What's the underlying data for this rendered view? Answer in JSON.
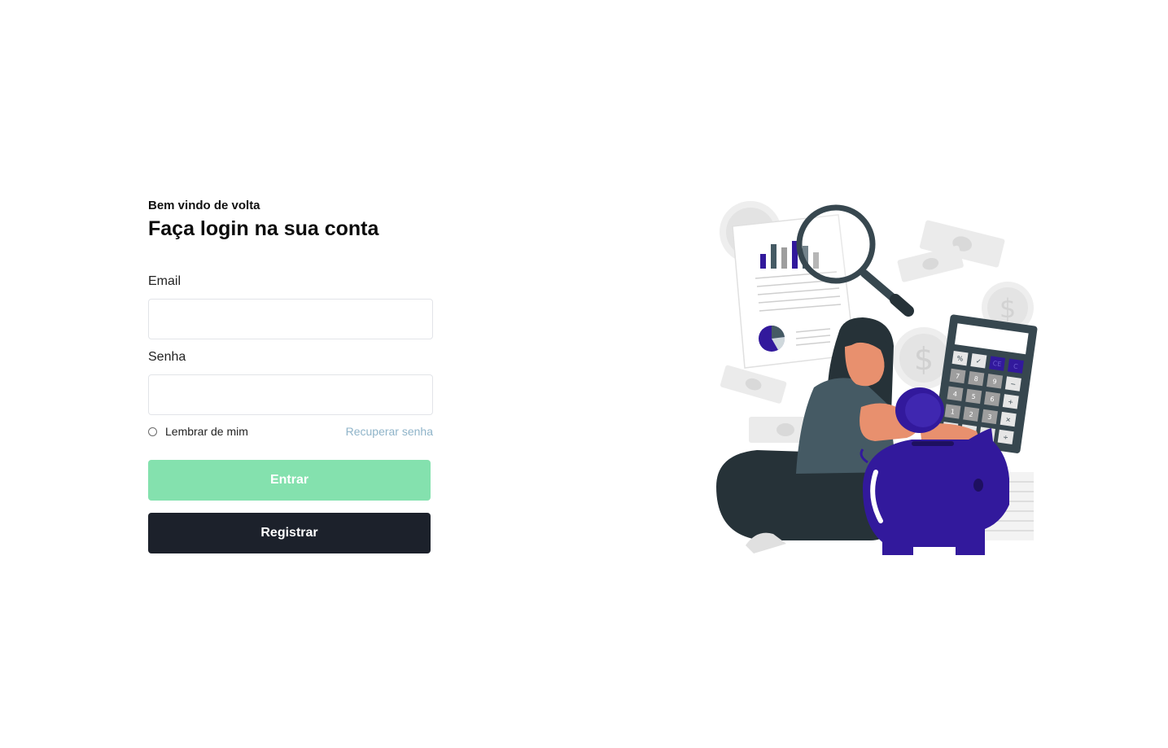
{
  "login": {
    "welcome": "Bem vindo de volta",
    "title": "Faça login na sua conta",
    "email_label": "Email",
    "email_value": "",
    "password_label": "Senha",
    "password_value": "",
    "remember_label": "Lembrar de mim",
    "recover_link": "Recuperar senha",
    "login_button": "Entrar",
    "register_button": "Registrar"
  },
  "illustration": {
    "subject": "woman-saving-coin-in-piggy-bank",
    "icons": [
      "magnifier-icon",
      "calculator-icon",
      "piggy-bank-icon",
      "coin-icon",
      "banknote-icon",
      "report-icon"
    ],
    "calculator_keys": [
      "%",
      "✓",
      "CE",
      "C",
      "7",
      "8",
      "9",
      "−",
      "4",
      "5",
      "6",
      "+",
      "1",
      "2",
      "3",
      "×",
      "0",
      ".",
      "=",
      "÷"
    ]
  },
  "colors": {
    "primary_button": "#84e1ae",
    "dark_button": "#1c212b",
    "link": "#8fb4c9",
    "accent_purple": "#32199c",
    "skin": "#e8906e",
    "dark_gray": "#263238"
  }
}
